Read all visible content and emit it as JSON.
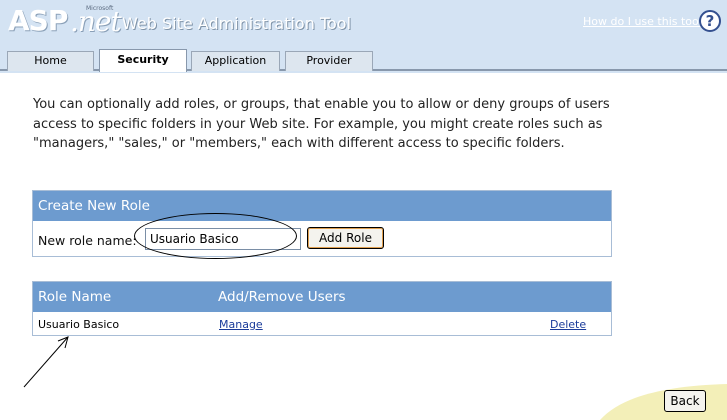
{
  "header": {
    "logo_asp": "ASP",
    "logo_net": ".net",
    "logo_microsoft": "Microsoft",
    "title": "Web Site Administration Tool",
    "help_link": "How do I use this tool?",
    "help_icon": "?"
  },
  "tabs": [
    {
      "label": "Home",
      "active": false
    },
    {
      "label": "Security",
      "active": true
    },
    {
      "label": "Application",
      "active": false
    },
    {
      "label": "Provider",
      "active": false
    }
  ],
  "intro": "You can optionally add roles, or groups, that enable you to allow or deny groups of users access to specific folders in your Web site. For example, you might create roles such as \"managers,\" \"sales,\" or \"members,\" each with different access to specific folders.",
  "create_role": {
    "heading": "Create New Role",
    "label": "New role name:",
    "input_value": "Usuario Basico",
    "button": "Add Role"
  },
  "roles_table": {
    "headers": [
      "Role Name",
      "Add/Remove Users"
    ],
    "rows": [
      {
        "name": "Usuario Basico",
        "manage": "Manage",
        "delete": "Delete"
      }
    ]
  },
  "footer": {
    "back_button": "Back"
  },
  "colors": {
    "header_bg": "#d4e3f3",
    "panel_header": "#6d9bcf",
    "link": "#1a3b9a"
  }
}
